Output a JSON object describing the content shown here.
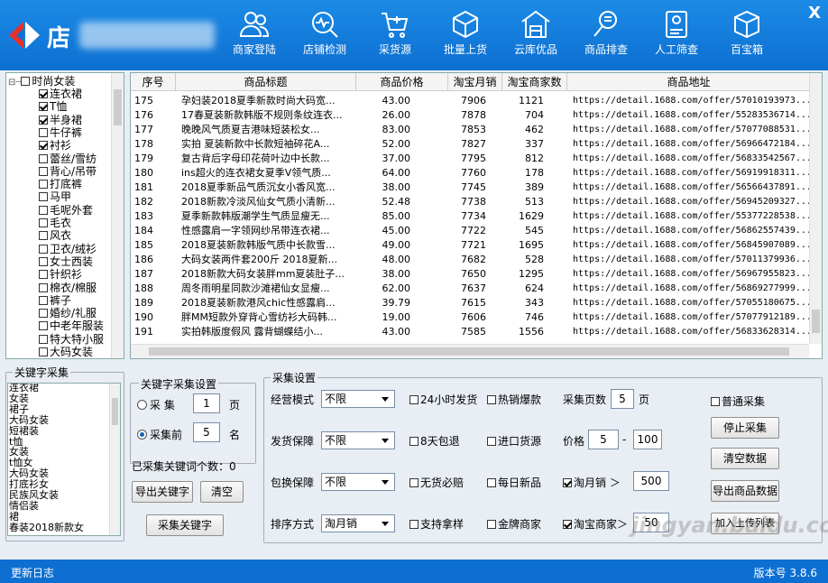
{
  "app": {
    "title": "店"
  },
  "nav": [
    {
      "label": "商家登陆",
      "icon": "users-icon"
    },
    {
      "label": "店铺检测",
      "icon": "search-pulse-icon"
    },
    {
      "label": "采货源",
      "icon": "cart-icon"
    },
    {
      "label": "批量上货",
      "icon": "box-icon"
    },
    {
      "label": "云库优品",
      "icon": "warehouse-icon"
    },
    {
      "label": "商品排查",
      "icon": "magnifier-icon"
    },
    {
      "label": "人工筛查",
      "icon": "id-card-icon"
    },
    {
      "label": "百宝箱",
      "icon": "cube-icon"
    }
  ],
  "tree": {
    "root": "时尚女装",
    "items": [
      {
        "label": "连衣裙",
        "checked": true
      },
      {
        "label": "T恤",
        "checked": true
      },
      {
        "label": "半身裙",
        "checked": true
      },
      {
        "label": "牛仔裤",
        "checked": false
      },
      {
        "label": "衬衫",
        "checked": true
      },
      {
        "label": "蕾丝/雪纺",
        "checked": false
      },
      {
        "label": "背心/吊带",
        "checked": false
      },
      {
        "label": "打底裤",
        "checked": false
      },
      {
        "label": "马甲",
        "checked": false
      },
      {
        "label": "毛呢外套",
        "checked": false
      },
      {
        "label": "毛衣",
        "checked": false
      },
      {
        "label": "风衣",
        "checked": false
      },
      {
        "label": "卫衣/绒衫",
        "checked": false
      },
      {
        "label": "女士西装",
        "checked": false
      },
      {
        "label": "针织衫",
        "checked": false
      },
      {
        "label": "棉衣/棉服",
        "checked": false
      },
      {
        "label": "裤子",
        "checked": false
      },
      {
        "label": "婚纱/礼服",
        "checked": false
      },
      {
        "label": "中老年服装",
        "checked": false
      },
      {
        "label": "特大特小服",
        "checked": false
      },
      {
        "label": "大码女装",
        "checked": false
      }
    ]
  },
  "table": {
    "headers": [
      "序号",
      "商品标题",
      "商品价格",
      "淘宝月销",
      "淘宝商家数",
      "商品地址"
    ],
    "rows": [
      [
        "175",
        "孕妇装2018夏季新款时尚大码宽...",
        "43.00",
        "7906",
        "1121",
        "https://detail.1688.com/offer/57010193973..."
      ],
      [
        "176",
        "17春夏装新款韩版不规则条纹连衣...",
        "26.00",
        "7878",
        "704",
        "https://detail.1688.com/offer/55283536714..."
      ],
      [
        "177",
        "晚晚风气质夏吉港味短装松女...",
        "83.00",
        "7853",
        "462",
        "https://detail.1688.com/offer/57077088531..."
      ],
      [
        "178",
        "实拍 夏装新款中长款短袖碎花A...",
        "52.00",
        "7827",
        "337",
        "https://detail.1688.com/offer/56966472184..."
      ],
      [
        "179",
        "复古背后字母印花荷叶边中长款...",
        "37.00",
        "7795",
        "812",
        "https://detail.1688.com/offer/56833542567..."
      ],
      [
        "180",
        "ins超火的连衣裙女夏季V领气质...",
        "64.00",
        "7760",
        "178",
        "https://detail.1688.com/offer/56919918311..."
      ],
      [
        "181",
        "2018夏季新品气质沉女小香风宽...",
        "38.00",
        "7745",
        "389",
        "https://detail.1688.com/offer/56566437891..."
      ],
      [
        "182",
        "2018新款冷淡风仙女气质小清新...",
        "52.48",
        "7738",
        "513",
        "https://detail.1688.com/offer/56945209327..."
      ],
      [
        "183",
        "夏季新款韩版潮学生气质显瘦无...",
        "85.00",
        "7734",
        "1629",
        "https://detail.1688.com/offer/55377228538..."
      ],
      [
        "184",
        "性感露肩一字领网纱吊带连衣裙...",
        "45.00",
        "7722",
        "545",
        "https://detail.1688.com/offer/56862557439..."
      ],
      [
        "185",
        "2018夏装新款韩版气质中长款雪...",
        "49.00",
        "7721",
        "1695",
        "https://detail.1688.com/offer/56845907089..."
      ],
      [
        "186",
        "大码女装两件套200斤 2018夏新...",
        "48.00",
        "7682",
        "528",
        "https://detail.1688.com/offer/57011379936..."
      ],
      [
        "187",
        "2018新款大码女装胖mm夏装肚子...",
        "38.00",
        "7650",
        "1295",
        "https://detail.1688.com/offer/56967955823..."
      ],
      [
        "188",
        "周冬雨明星同款沙滩裙仙女显瘦...",
        "62.00",
        "7637",
        "624",
        "https://detail.1688.com/offer/56869277999..."
      ],
      [
        "189",
        "2018夏装新款港风chic性感露肩...",
        "39.79",
        "7615",
        "343",
        "https://detail.1688.com/offer/57055180675..."
      ],
      [
        "190",
        "胖MM短款外穿背心雪纺衫大码韩...",
        "19.00",
        "7606",
        "746",
        "https://detail.1688.com/offer/57077912189..."
      ],
      [
        "191",
        "实拍韩版度假风 露背蝴蝶结小...",
        "43.00",
        "7585",
        "1556",
        "https://detail.1688.com/offer/56833628314..."
      ]
    ]
  },
  "keywords": {
    "legend": "关键字采集",
    "items": [
      "连衣裙",
      "女装",
      "裙子",
      "大码女装",
      "短裙装",
      "t恤",
      "女装",
      "t恤女",
      "大码女装",
      "打底衫女",
      "民族风女装",
      "情侣装",
      "裙",
      "春装2018新款女"
    ],
    "settings_legend": "关键字采集设置",
    "radio1_label": "采 集",
    "radio1_value": "1",
    "radio1_unit": "页",
    "radio2_label": "采集前",
    "radio2_value": "5",
    "radio2_unit": "名",
    "count_label": "已采集关键词个数：0",
    "export_button": "导出关键字",
    "clear_button": "清空",
    "collect_button": "采集关键字"
  },
  "settings": {
    "legend": "采集设置",
    "row1_label": "经营模式",
    "row1_value": "不限",
    "row2_label": "发货保障",
    "row2_value": "不限",
    "row3_label": "包换保障",
    "row3_value": "不限",
    "row4_label": "排序方式",
    "row4_value": "淘月销",
    "checks": [
      {
        "label": "24小时发货",
        "checked": false
      },
      {
        "label": "热销爆款",
        "checked": false
      },
      {
        "label": "8天包退",
        "checked": false
      },
      {
        "label": "进口货源",
        "checked": false
      },
      {
        "label": "无货必赔",
        "checked": false
      },
      {
        "label": "每日新品",
        "checked": false
      },
      {
        "label": "支持拿样",
        "checked": false
      },
      {
        "label": "金牌商家",
        "checked": false
      }
    ],
    "pages_label": "采集页数",
    "pages_value": "5",
    "pages_unit": "页",
    "price_label": "价格",
    "price_min": "5",
    "price_dash": "-",
    "price_max": "100",
    "monthly_label": "淘月销 ＞",
    "monthly_checked": true,
    "monthly_value": "500",
    "merchant_label": "淘宝商家＞",
    "merchant_checked": true,
    "merchant_value": "50",
    "normal_label": "普通采集",
    "normal_checked": false,
    "stop_button": "停止采集",
    "clear_data_button": "清空数据",
    "export_button": "导出商品数据",
    "add_button": "加入上传列表"
  },
  "footer": {
    "left": "更新日志",
    "right": "版本号 3.8.6"
  },
  "watermark": "jingyan.baidu.com"
}
